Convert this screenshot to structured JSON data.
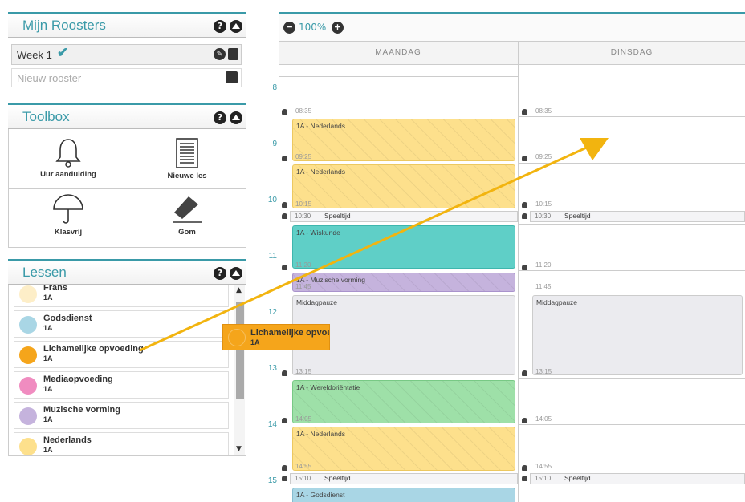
{
  "roosters": {
    "title": "Mijn Roosters",
    "week": "Week 1",
    "new_placeholder": "Nieuw rooster"
  },
  "toolbox": {
    "title": "Toolbox",
    "items": [
      {
        "label": "Uur aanduiding",
        "icon": "bell-icon"
      },
      {
        "label": "Nieuwe les",
        "icon": "document-icon"
      },
      {
        "label": "Klasvrij",
        "icon": "umbrella-icon"
      },
      {
        "label": "Gom",
        "icon": "eraser-icon"
      }
    ]
  },
  "lessen": {
    "title": "Lessen",
    "items": [
      {
        "name": "Frans",
        "class": "1A",
        "color": "#fdeec8"
      },
      {
        "name": "Godsdienst",
        "class": "1A",
        "color": "#a9d6e5"
      },
      {
        "name": "Lichamelijke opvoeding",
        "class": "1A",
        "color": "#f5a51b"
      },
      {
        "name": "Mediaopvoeding",
        "class": "1A",
        "color": "#f08cc0"
      },
      {
        "name": "Muzische vorming",
        "class": "1A",
        "color": "#c5b3dd"
      },
      {
        "name": "Nederlands",
        "class": "1A",
        "color": "#fde08c"
      }
    ]
  },
  "drag": {
    "name": "Lichamelijke opvoeding",
    "class": "1A"
  },
  "calendar": {
    "zoom": "100%",
    "days": [
      "MAANDAG",
      "DINSDAG"
    ],
    "hours": [
      "8",
      "9",
      "10",
      "11",
      "12",
      "13",
      "14",
      "15"
    ],
    "monday": {
      "times": [
        "08:35",
        "09:25",
        "10:15",
        "10:30",
        "11:20",
        "11:45",
        "13:15",
        "14:05",
        "14:55",
        "15:10"
      ],
      "events": [
        "1A - Nederlands",
        "1A - Nederlands",
        "Speeltijd",
        "1A - Wiskunde",
        "1A - Muzische vorming",
        "Middagpauze",
        "1A - Wereldoriëntatie",
        "1A - Nederlands",
        "Speeltijd",
        "1A - Godsdienst"
      ]
    },
    "tuesday": {
      "times": [
        "08:35",
        "09:25",
        "10:15",
        "10:30",
        "11:20",
        "11:45",
        "13:15",
        "14:05",
        "14:55",
        "15:10"
      ],
      "events": [
        "Speeltijd",
        "Middagpauze",
        "Speeltijd"
      ]
    }
  },
  "colors": {
    "accent": "#3a9aa8",
    "nederlands": "#fde08c",
    "wiskunde": "#5fcfc7",
    "muzische": "#c5b3dd",
    "wereld": "#9ee0a8",
    "godsdienst": "#a9d6e5",
    "pauze": "#ebebef",
    "arrow": "#f2b40f"
  }
}
